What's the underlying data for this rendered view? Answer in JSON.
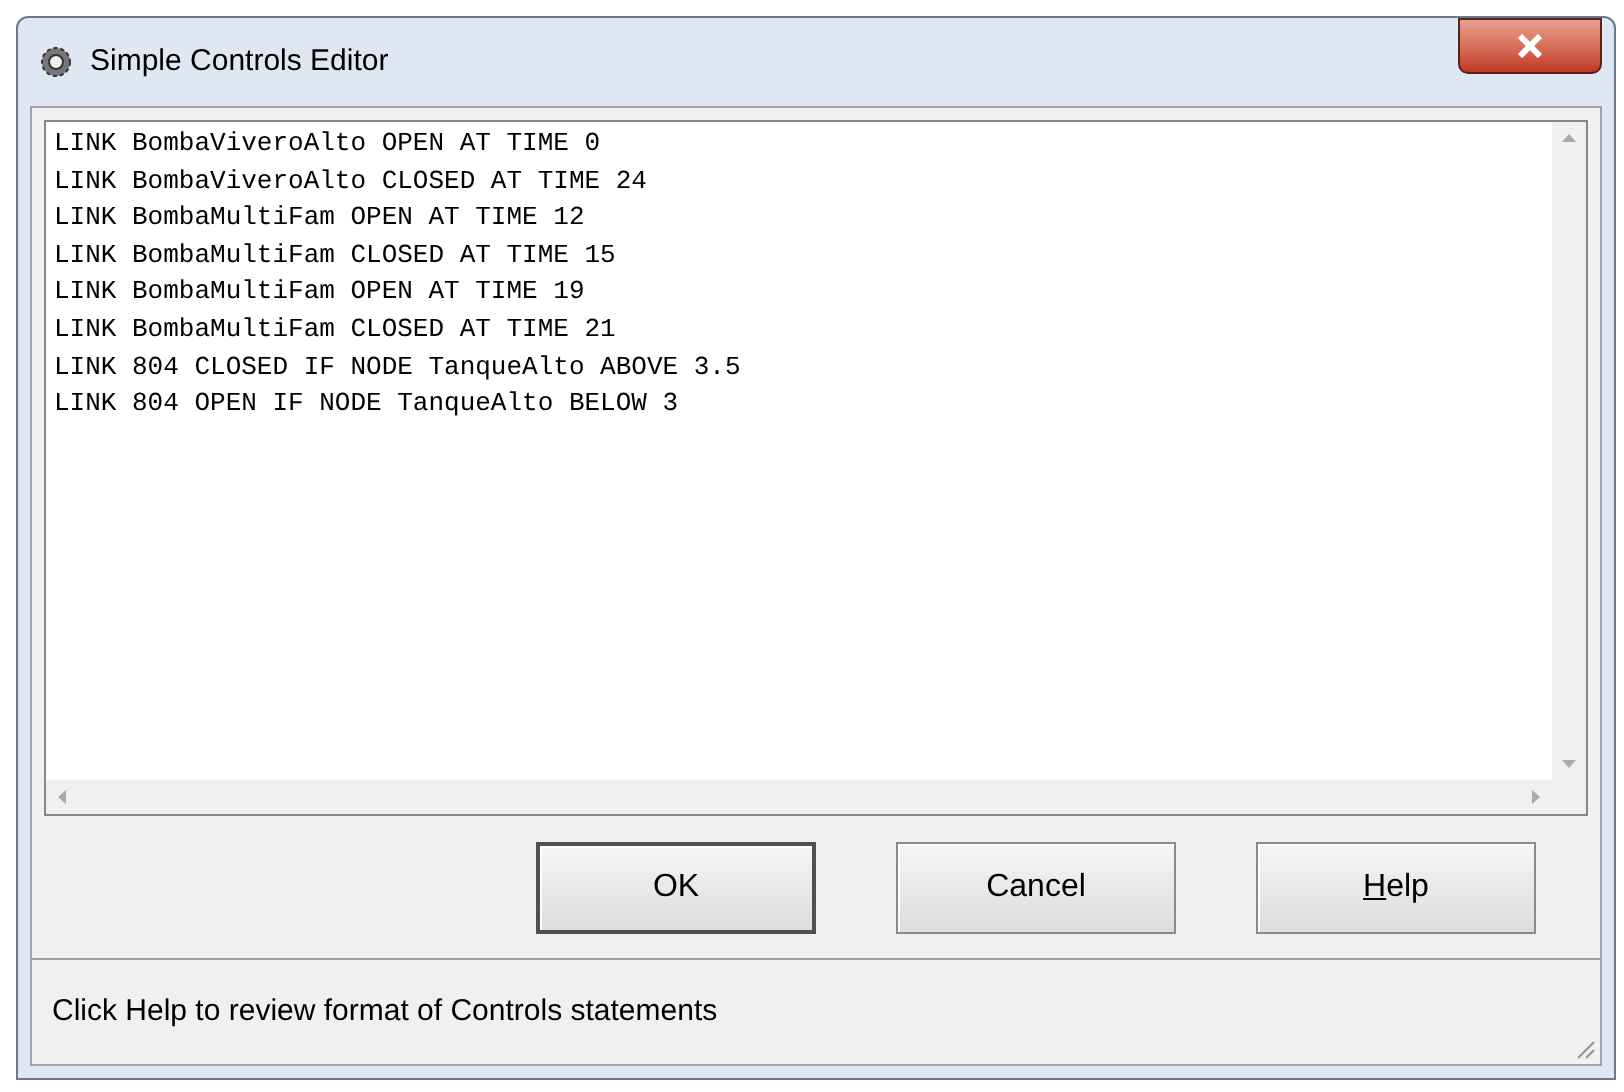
{
  "window": {
    "title": "Simple Controls Editor"
  },
  "editor": {
    "lines": [
      "LINK BombaViveroAlto OPEN AT TIME 0",
      "LINK BombaViveroAlto CLOSED AT TIME 24",
      "LINK BombaMultiFam OPEN AT TIME 12",
      "LINK BombaMultiFam CLOSED AT TIME 15",
      "LINK BombaMultiFam OPEN AT TIME 19",
      "LINK BombaMultiFam CLOSED AT TIME 21",
      "LINK 804 CLOSED IF NODE TanqueAlto ABOVE 3.5",
      "LINK 804 OPEN IF NODE TanqueAlto BELOW 3"
    ]
  },
  "buttons": [
    {
      "label": "OK",
      "default": true,
      "mnemonic_underlined": false
    },
    {
      "label": "Cancel",
      "default": false,
      "mnemonic_underlined": false
    },
    {
      "label": "Help",
      "default": false,
      "mnemonic_underlined": true
    }
  ],
  "status_bar": "Click Help to review format of Controls statements"
}
